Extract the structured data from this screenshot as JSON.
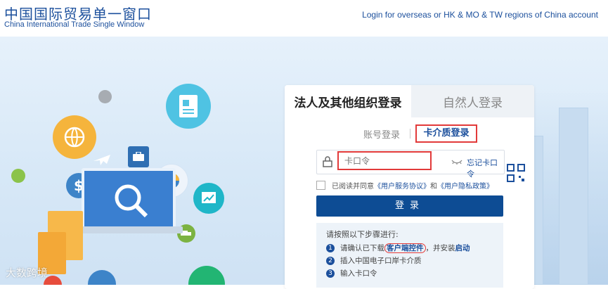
{
  "header": {
    "logo_cn": "中国国际贸易单一窗口",
    "logo_en": "China International Trade Single Window",
    "overseas_link": "Login for overseas or HK & MO & TW regions of China account"
  },
  "login": {
    "tabs": [
      {
        "label": "法人及其他组织登录",
        "active": true
      },
      {
        "label": "自然人登录",
        "active": false
      }
    ],
    "subtabs": [
      {
        "label": "账号登录",
        "active": false
      },
      {
        "label": "卡介质登录",
        "active": true
      }
    ],
    "pin_placeholder": "卡口令",
    "forgot_pin": "忘记卡口令",
    "agreement": {
      "prefix": "已阅读并同意",
      "service_agreement": "《用户服务协议》",
      "and": "和",
      "privacy_policy": "《用户隐私政策》"
    },
    "login_button": "登录",
    "steps": {
      "title": "请按照以下步骤进行:",
      "items": [
        {
          "number": "1",
          "pre": "请确认已下载",
          "link": "客户端控件",
          "mid": "，并安装",
          "link2": "启动"
        },
        {
          "number": "2",
          "text": "插入中国电子口岸卡介质"
        },
        {
          "number": "3",
          "text": "输入卡口令"
        }
      ]
    }
  },
  "watermark": "大数跨境",
  "colors": {
    "brand_blue": "#1b4f9c",
    "button_blue": "#0d4c94",
    "highlight_red": "#e23a3a"
  }
}
